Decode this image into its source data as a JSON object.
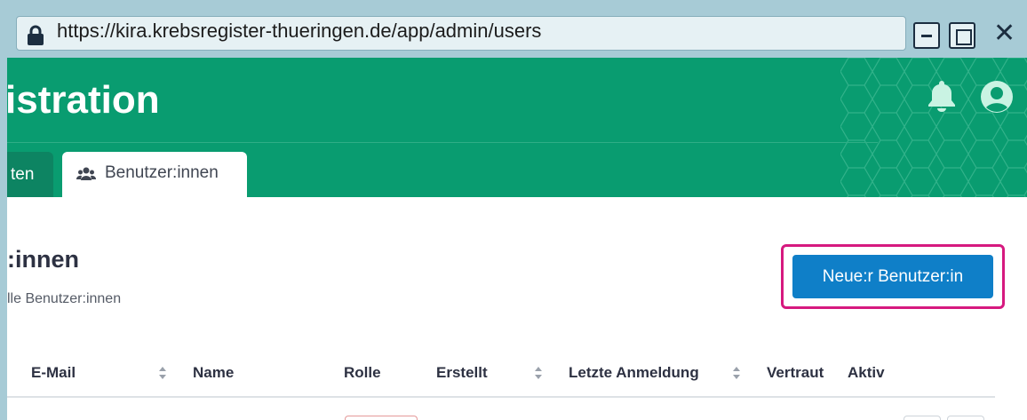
{
  "browser": {
    "url": "https://kira.krebsregister-thueringen.de/app/admin/users",
    "icons": [
      "lock-icon",
      "minimize-icon",
      "maximize-icon",
      "close-icon"
    ]
  },
  "header": {
    "title": "istration",
    "icons": [
      "bell-icon",
      "user-circle-icon"
    ],
    "tabs": [
      {
        "label": "ten",
        "active": false
      },
      {
        "label": "Benutzer:innen",
        "active": true,
        "icon": "users-icon"
      }
    ]
  },
  "main": {
    "title": ":innen",
    "subtitle": "lle Benutzer:innen",
    "new_user_button": "Neue:r Benutzer:in"
  },
  "table": {
    "columns": [
      {
        "label": "E-Mail",
        "sortable": true
      },
      {
        "label": "Name",
        "sortable": false
      },
      {
        "label": "Rolle",
        "sortable": false
      },
      {
        "label": "Erstellt",
        "sortable": true
      },
      {
        "label": "Letzte Anmeldung",
        "sortable": true
      },
      {
        "label": "Vertraut",
        "sortable": false
      },
      {
        "label": "Aktiv",
        "sortable": false
      }
    ]
  },
  "colors": {
    "header_green": "#099c70",
    "primary_button": "#0f7fc8",
    "highlight_magenta": "#d6197f",
    "frame": "#a7cbd6"
  }
}
